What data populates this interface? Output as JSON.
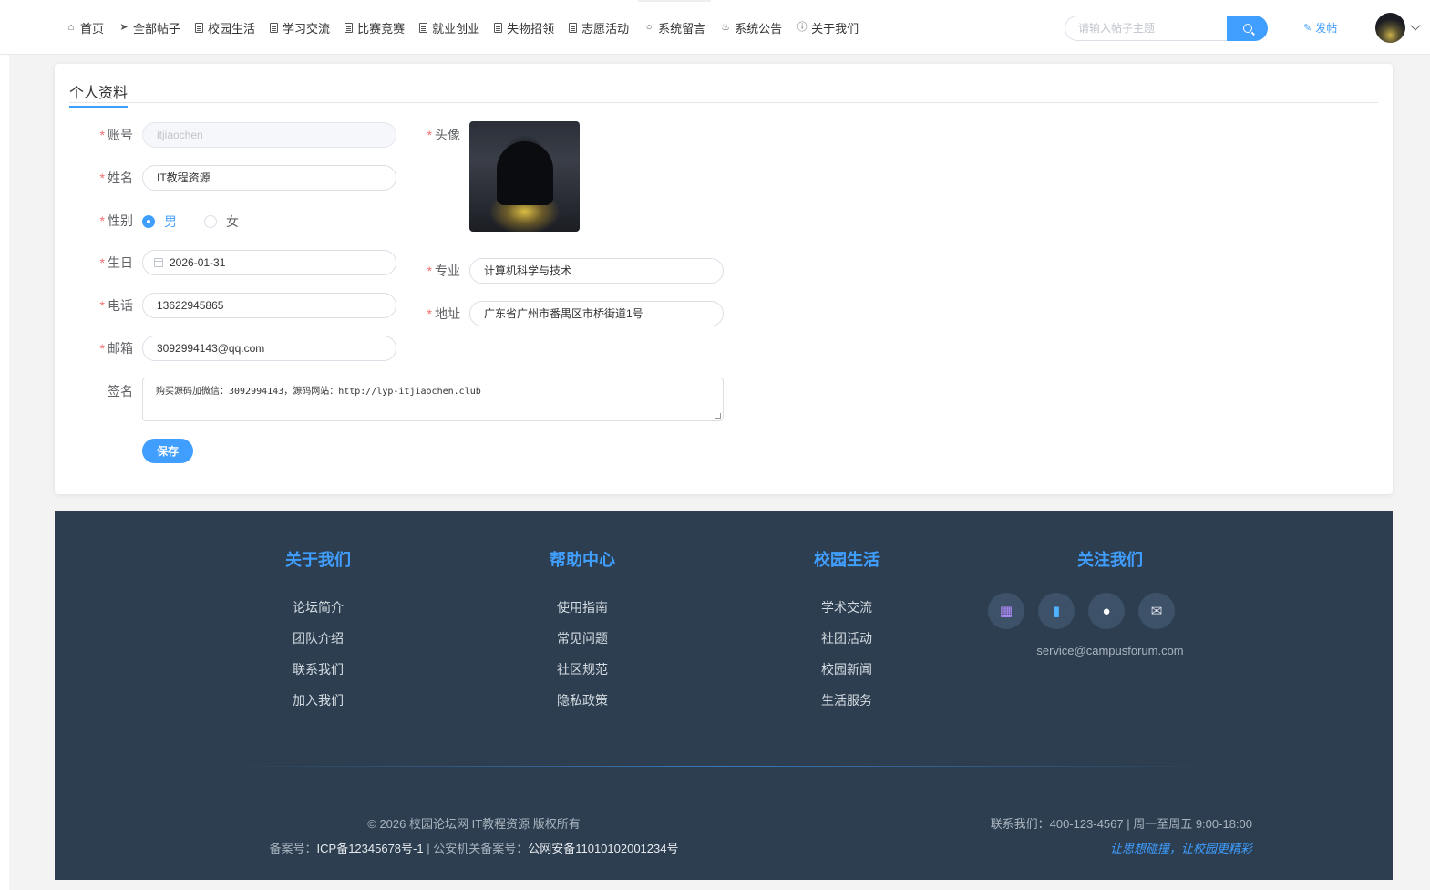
{
  "nav": {
    "items": [
      {
        "label": "首页",
        "icon": "home-icon"
      },
      {
        "label": "全部帖子",
        "icon": "send-icon"
      },
      {
        "label": "校园生活",
        "icon": "document-icon"
      },
      {
        "label": "学习交流",
        "icon": "document-icon"
      },
      {
        "label": "比赛竞赛",
        "icon": "document-icon"
      },
      {
        "label": "就业创业",
        "icon": "document-icon"
      },
      {
        "label": "失物招领",
        "icon": "document-icon"
      },
      {
        "label": "志愿活动",
        "icon": "document-icon"
      },
      {
        "label": "系统留言",
        "icon": "chat-icon"
      },
      {
        "label": "系统公告",
        "icon": "bell-icon"
      },
      {
        "label": "关于我们",
        "icon": "info-icon"
      }
    ],
    "search_placeholder": "请输入帖子主题",
    "post_label": "发帖"
  },
  "profile": {
    "title": "个人资料",
    "fields": {
      "account": {
        "label": "账号",
        "value": "itjiaochen"
      },
      "name": {
        "label": "姓名",
        "value": "IT教程资源"
      },
      "gender": {
        "label": "性别",
        "options": [
          "男",
          "女"
        ],
        "selected": "男"
      },
      "birthday": {
        "label": "生日",
        "value": "2026-01-31"
      },
      "phone": {
        "label": "电话",
        "value": "13622945865"
      },
      "email": {
        "label": "邮箱",
        "value": "3092994143@qq.com"
      },
      "avatar": {
        "label": "头像"
      },
      "major": {
        "label": "专业",
        "value": "计算机科学与技术"
      },
      "address": {
        "label": "地址",
        "value": "广东省广州市番禺区市桥街道1号"
      },
      "signature": {
        "label": "签名",
        "value": "购买源码加微信：3092994143，源码网站：http://lyp-itjiaochen.club"
      }
    },
    "save_label": "保存"
  },
  "footer": {
    "columns": [
      {
        "title": "关于我们",
        "links": [
          "论坛简介",
          "团队介绍",
          "联系我们",
          "加入我们"
        ]
      },
      {
        "title": "帮助中心",
        "links": [
          "使用指南",
          "常见问题",
          "社区规范",
          "隐私政策"
        ]
      },
      {
        "title": "校园生活",
        "links": [
          "学术交流",
          "社团活动",
          "校园新闻",
          "生活服务"
        ]
      }
    ],
    "follow": {
      "title": "关注我们",
      "icons": [
        "app-icon",
        "book-icon",
        "chat-bubble-icon",
        "mail-icon"
      ],
      "email": "service@campusforum.com"
    },
    "copyright": "© 2026 校园论坛网 IT教程资源 版权所有",
    "icp_prefix": "备案号：",
    "icp": "ICP备12345678号-1",
    "police_prefix": " | 公安机关备案号：",
    "police": "公网安备11010102001234号",
    "contact": "联系我们：400-123-4567 | 周一至周五 9:00-18:00",
    "slogan": "让思想碰撞，让校园更精彩"
  },
  "colors": {
    "accent": "#409eff",
    "footer_bg": "#2c3e50",
    "required": "#f56c6c"
  }
}
